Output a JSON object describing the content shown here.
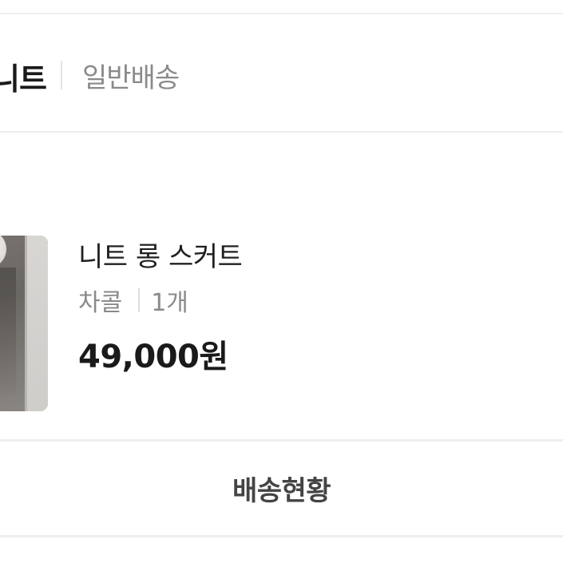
{
  "header": {
    "title_fragment": "니트",
    "shipping_type": "일반배송"
  },
  "product": {
    "name": "니트 롱 스커트",
    "option_color": "차콜",
    "quantity": "1개",
    "price": "49,000원",
    "thumbnail_alt": "product-photo"
  },
  "actions": {
    "delivery_status_label": "배송현황"
  }
}
